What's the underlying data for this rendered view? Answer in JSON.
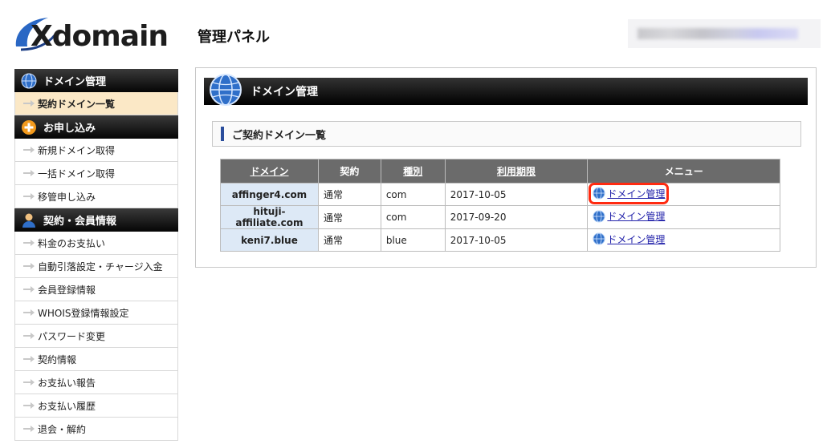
{
  "header": {
    "logo_text": "Xdomain",
    "panel_title": "管理パネル"
  },
  "sidebar": {
    "sections": [
      {
        "title": "ドメイン管理",
        "icon": "globe-icon",
        "items": [
          {
            "label": "契約ドメイン一覧",
            "active": true
          }
        ]
      },
      {
        "title": "お申し込み",
        "icon": "plus-circle-icon",
        "items": [
          {
            "label": "新規ドメイン取得"
          },
          {
            "label": "一括ドメイン取得"
          },
          {
            "label": "移管申し込み"
          }
        ]
      },
      {
        "title": "契約・会員情報",
        "icon": "user-icon",
        "items": [
          {
            "label": "料金のお支払い"
          },
          {
            "label": "自動引落設定・チャージ入金"
          },
          {
            "label": "会員登録情報"
          },
          {
            "label": "WHOIS登録情報設定"
          },
          {
            "label": "パスワード変更"
          },
          {
            "label": "契約情報"
          },
          {
            "label": "お支払い報告"
          },
          {
            "label": "お支払い履歴"
          },
          {
            "label": "退会・解約"
          }
        ]
      }
    ]
  },
  "main": {
    "title": "ドメイン管理",
    "subtitle": "ご契約ドメイン一覧",
    "table": {
      "headers": [
        "ドメイン",
        "契約",
        "種別",
        "利用期限",
        "メニュー"
      ],
      "rows": [
        {
          "domain": "affinger4.com",
          "contract": "通常",
          "type": "com",
          "expires": "2017-10-05",
          "menu": "ドメイン管理"
        },
        {
          "domain": "hituji-affiliate.com",
          "contract": "通常",
          "type": "com",
          "expires": "2017-09-20",
          "menu": "ドメイン管理"
        },
        {
          "domain": "keni7.blue",
          "contract": "通常",
          "type": "blue",
          "expires": "2017-10-05",
          "menu": "ドメイン管理"
        }
      ]
    }
  },
  "colors": {
    "active_item_bg": "#fbe8c6",
    "highlight": "#ff2a10",
    "table_header": "#6b6b6b",
    "domain_cell_bg": "#dde9f6",
    "link": "#2222aa"
  }
}
